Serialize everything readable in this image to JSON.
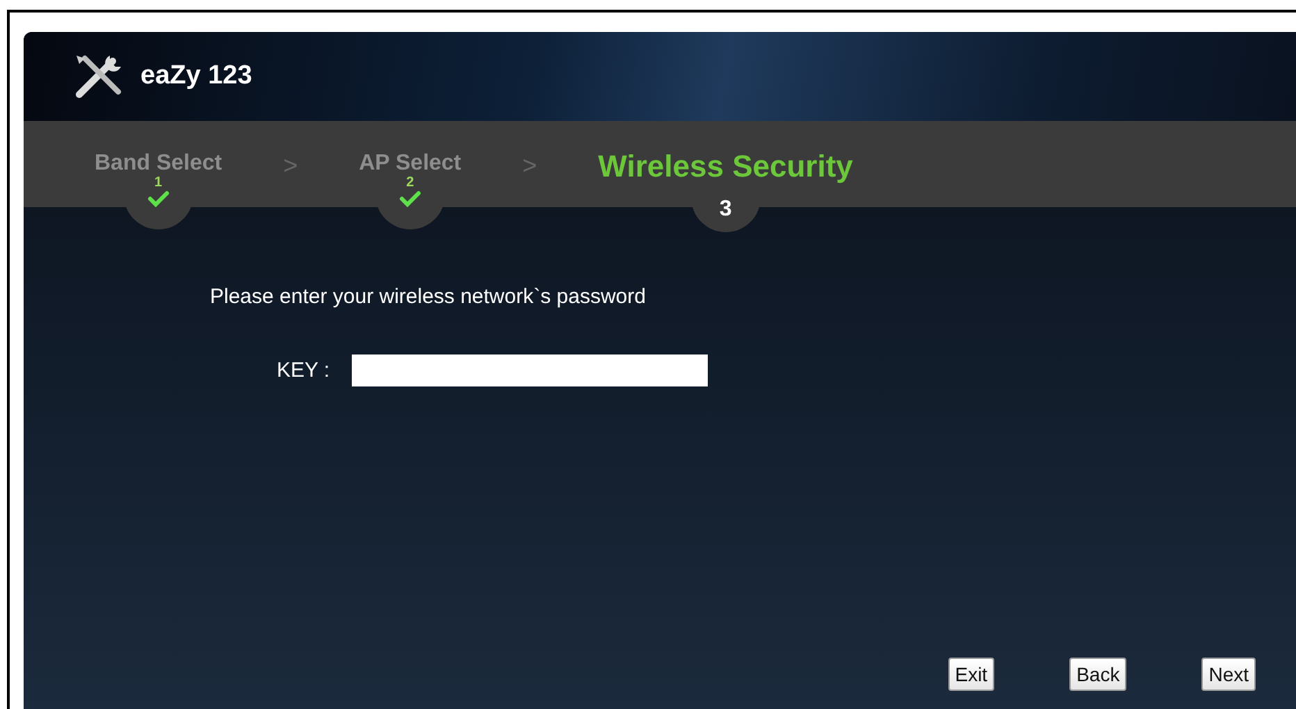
{
  "app": {
    "title": "eaZy 123"
  },
  "steps": [
    {
      "label": "Band Select",
      "number": "1",
      "done": true,
      "selected": false
    },
    {
      "label": "AP Select",
      "number": "2",
      "done": true,
      "selected": false
    },
    {
      "label": "Wireless Security",
      "number": "3",
      "done": false,
      "selected": true
    }
  ],
  "separator": ">",
  "prompt": "Please enter your wireless network`s password",
  "key_field": {
    "label": "KEY :"
  },
  "buttons": [
    "Exit",
    "Back",
    "Next"
  ]
}
